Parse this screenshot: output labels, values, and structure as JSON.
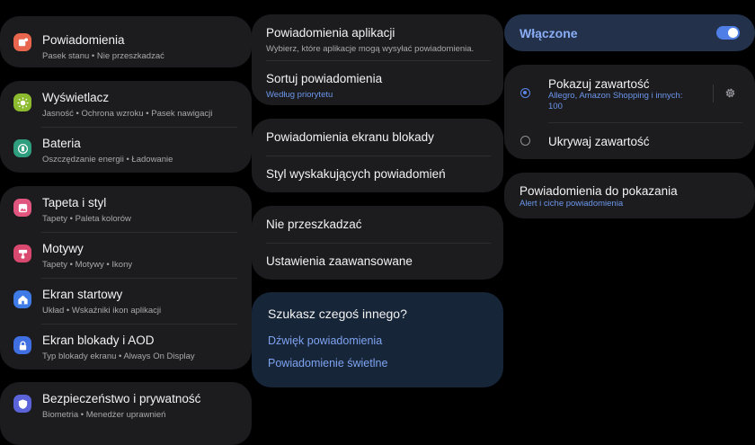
{
  "left": {
    "groups": [
      {
        "items": [
          {
            "title": "Powiadomienia",
            "subtitle": "Pasek stanu  •  Nie przeszkadzać",
            "icon": "notifications-icon",
            "color": "#e8664d"
          }
        ]
      },
      {
        "items": [
          {
            "title": "Wyświetlacz",
            "subtitle": "Jasność  •  Ochrona wzroku  •  Pasek nawigacji",
            "icon": "sun-icon",
            "color": "#8dbb2f"
          },
          {
            "title": "Bateria",
            "subtitle": "Oszczędzanie energii  •  Ładowanie",
            "icon": "battery-icon",
            "color": "#2e9e7e"
          }
        ]
      },
      {
        "items": [
          {
            "title": "Tapeta i styl",
            "subtitle": "Tapety  •  Paleta kolorów",
            "icon": "wallpaper-icon",
            "color": "#e0567f"
          },
          {
            "title": "Motywy",
            "subtitle": "Tapety  •  Motywy  •  Ikony",
            "icon": "themes-icon",
            "color": "#d9486f"
          },
          {
            "title": "Ekran startowy",
            "subtitle": "Układ  •  Wskaźniki ikon aplikacji",
            "icon": "home-icon",
            "color": "#3f7be7"
          },
          {
            "title": "Ekran blokady i AOD",
            "subtitle": "Typ blokady ekranu  •  Always On Display",
            "icon": "lock-icon",
            "color": "#3f6fe0"
          }
        ]
      },
      {
        "items": [
          {
            "title": "Bezpieczeństwo i prywatność",
            "subtitle": "Biometria  •  Menedżer uprawnień",
            "icon": "shield-icon",
            "color": "#5b63d9"
          }
        ]
      }
    ]
  },
  "middle": {
    "app_notifications": {
      "title": "Powiadomienia aplikacji",
      "subtitle": "Wybierz, które aplikacje mogą wysyłać powiadomienia."
    },
    "sort": {
      "title": "Sortuj powiadomienia",
      "subtitle": "Według priorytetu"
    },
    "lock_screen": {
      "title": "Powiadomienia ekranu blokady"
    },
    "popup_style": {
      "title": "Styl wyskakujących powiadomień"
    },
    "dnd": {
      "title": "Nie przeszkadzać"
    },
    "advanced": {
      "title": "Ustawienia zaawansowane"
    },
    "looking": {
      "title": "Szukasz czegoś innego?",
      "links": [
        "Dźwięk powiadomienia",
        "Powiadomienie świetlne"
      ]
    }
  },
  "right": {
    "master": {
      "label": "Włączone",
      "enabled": true
    },
    "show_content": {
      "title": "Pokazuj zawartość",
      "subtitle": "Allegro, Amazon Shopping i innych: 100",
      "selected": true
    },
    "hide_content": {
      "title": "Ukrywaj zawartość",
      "selected": false
    },
    "to_show": {
      "title": "Powiadomienia do pokazania",
      "subtitle": "Alert i ciche powiadomienia"
    }
  },
  "colors": {
    "accent": "#4f7fe6",
    "card": "#1c1c1e",
    "link": "#7ea3f0"
  }
}
